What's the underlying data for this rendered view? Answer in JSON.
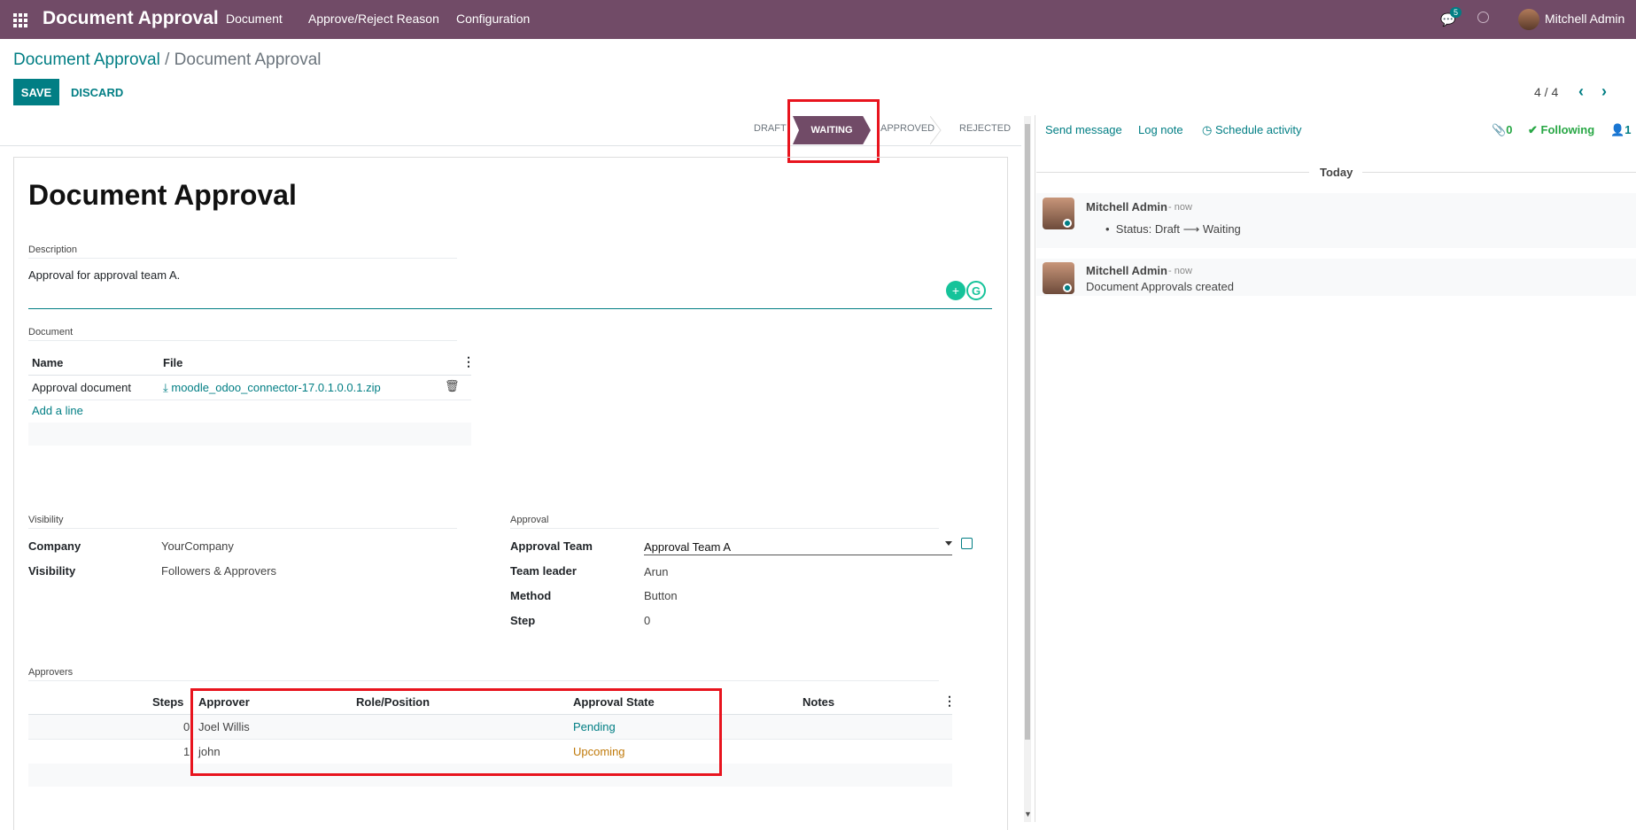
{
  "nav": {
    "brand": "Document Approval",
    "menu": [
      "Document",
      "Approve/Reject Reason",
      "Configuration"
    ],
    "chat_count": "5",
    "user": "Mitchell Admin"
  },
  "breadcrumb": {
    "parent": "Document Approval",
    "sep": " / ",
    "current": "Document Approval"
  },
  "actions": {
    "save": "SAVE",
    "discard": "DISCARD"
  },
  "pager": {
    "value": "4 / 4",
    "prev": "‹",
    "next": "›"
  },
  "statusbar": {
    "stages": [
      "DRAFT",
      "WAITING",
      "APPROVED",
      "REJECTED"
    ],
    "active": "WAITING"
  },
  "form": {
    "title": "Document Approval",
    "description_label": "Description",
    "description_value": "Approval for approval team A.",
    "document_label": "Document",
    "doc_columns": [
      "Name",
      "File"
    ],
    "doc_rows": [
      {
        "name": "Approval document",
        "file": "moodle_odoo_connector-17.0.1.0.0.1.zip"
      }
    ],
    "add_line": "Add a line",
    "visibility_section": "Visibility",
    "company_label": "Company",
    "company_value": "YourCompany",
    "visibility_label": "Visibility",
    "visibility_value": "Followers & Approvers",
    "approval_section": "Approval",
    "team_label": "Approval Team",
    "team_value": "Approval Team A",
    "leader_label": "Team leader",
    "leader_value": "Arun",
    "method_label": "Method",
    "method_value": "Button",
    "step_label": "Step",
    "step_value": "0",
    "approvers_label": "Approvers",
    "approver_columns": [
      "Steps",
      "Approver",
      "Role/Position",
      "Approval State",
      "Notes"
    ],
    "approver_rows": [
      {
        "step": "0",
        "approver": "Joel Willis",
        "role": "",
        "state": "Pending"
      },
      {
        "step": "1",
        "approver": "john",
        "role": "",
        "state": "Upcoming"
      }
    ]
  },
  "chatter": {
    "send_message": "Send message",
    "log_note": "Log note",
    "schedule": "Schedule activity",
    "attachments": "0",
    "following": "Following",
    "followers": "1",
    "today": "Today",
    "messages": [
      {
        "author": "Mitchell Admin",
        "when": "- now",
        "status_prefix": "Status: Draft",
        "arrow": "⟶",
        "status_to": "Waiting"
      },
      {
        "author": "Mitchell Admin",
        "when": "- now",
        "body": "Document Approvals created"
      }
    ]
  },
  "colors": {
    "brand": "#714B67",
    "accent": "#017E84",
    "highlight": "#e8141e"
  }
}
